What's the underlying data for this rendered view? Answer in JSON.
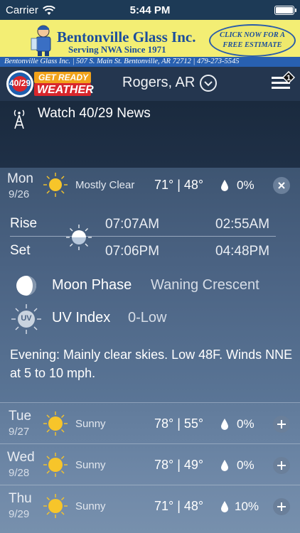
{
  "status_bar": {
    "carrier": "Carrier",
    "time": "5:44 PM"
  },
  "ad": {
    "business_name": "Bentonville Glass Inc.",
    "tagline": "Serving NWA Since 1971",
    "cta_line1": "CLICK NOW FOR A",
    "cta_line2": "FREE ESTIMATE",
    "contact_strip": "Bentonville Glass Inc. | 507 S. Main St. Bentonville, AR 72712 | 479-273-5545"
  },
  "header": {
    "logo_number": "40/29",
    "logo_line1": "GET READY",
    "logo_line2": "WEATHER",
    "location": "Rogers, AR",
    "notification_count": "1"
  },
  "watch": {
    "label": "Watch 40/29 News"
  },
  "today": {
    "day": "Mon",
    "date": "9/26",
    "condition": "Mostly Clear",
    "temps": "71° | 48°",
    "precip": "0%",
    "sun_rise_label": "Rise",
    "sun_set_label": "Set",
    "sunrise": "07:07AM",
    "sunset": "07:06PM",
    "moonrise": "02:55AM",
    "moonset": "04:48PM",
    "moon_phase_label": "Moon Phase",
    "moon_phase_value": "Waning Crescent",
    "uv_icon_text": "UV",
    "uv_label": "UV Index",
    "uv_value": "0-Low",
    "description": "Evening: Mainly clear skies. Low 48F. Winds NNE at 5 to 10 mph."
  },
  "forecast": [
    {
      "day": "Tue",
      "date": "9/27",
      "condition": "Sunny",
      "temps": "78° | 55°",
      "precip": "0%"
    },
    {
      "day": "Wed",
      "date": "9/28",
      "condition": "Sunny",
      "temps": "78° | 49°",
      "precip": "0%"
    },
    {
      "day": "Thu",
      "date": "9/29",
      "condition": "Sunny",
      "temps": "71° | 48°",
      "precip": "10%"
    }
  ],
  "colors": {
    "sun": "#f7c52a",
    "ad_bg": "#f3ee74",
    "ad_blue": "#1c4e9c",
    "logo_red": "#d8262c"
  }
}
